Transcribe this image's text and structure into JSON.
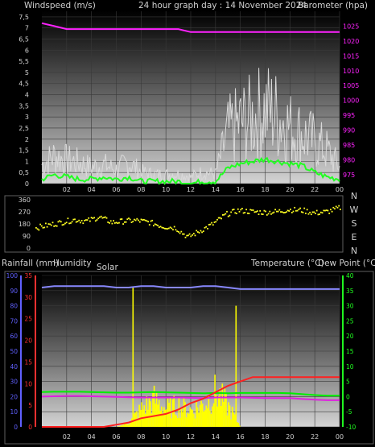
{
  "colors": {
    "background": "#000000",
    "text": "#d0d0d0",
    "windspeed": "#ffffff",
    "gust": "#d9d9d9",
    "wind_avg": "#22ff22",
    "barometer": "#ff22ff",
    "direction": "#ffff22",
    "humidity": "#8888ff",
    "rainfall": "#ff2020",
    "solar": "#ffff00",
    "temperature": "#00ee00",
    "dewpoint": "#e020e0",
    "axis_red": "#ff3030",
    "axis_blue": "#6060ff",
    "axis_green": "#20ff20"
  },
  "top_panel": {
    "title_left": "Windspeed (m/s)",
    "title_center": "24 hour graph day : 14 November 2024",
    "title_right": "Barometer (hpa)",
    "y_left_ticks": [
      "7,5",
      "7",
      "6,5",
      "6",
      "5,5",
      "5",
      "4,5",
      "4",
      "3,5",
      "3",
      "2,5",
      "2",
      "1,5",
      "1",
      "0,5",
      "0"
    ],
    "y_right_ticks": [
      "1025",
      "1020",
      "1015",
      "1010",
      "1005",
      "1000",
      "995",
      "990",
      "985",
      "980",
      "975"
    ],
    "x_ticks": [
      "02",
      "04",
      "06",
      "08",
      "10",
      "12",
      "14",
      "16",
      "18",
      "20",
      "22",
      "00"
    ]
  },
  "mid_panel": {
    "y_ticks": [
      "360",
      "270",
      "180",
      "90",
      "0"
    ],
    "compass": [
      "N",
      "W",
      "S",
      "E",
      "N"
    ]
  },
  "bottom_panel": {
    "label_rain": "Rainfall (mm)",
    "label_humidity": "Humidity",
    "label_solar": "Solar",
    "label_temp": "Temperature (°C)",
    "label_dew": "Dew Point (°C)",
    "humidity_ticks": [
      "100",
      "90",
      "80",
      "70",
      "60",
      "50",
      "40",
      "30",
      "20",
      "10",
      "0"
    ],
    "rain_ticks": [
      "35",
      "30",
      "25",
      "20",
      "15",
      "10",
      "5",
      "0"
    ],
    "temp_ticks": [
      "40",
      "35",
      "30",
      "25",
      "20",
      "15",
      "10",
      "5",
      "0",
      "-5",
      "-10"
    ],
    "x_ticks": [
      "02",
      "04",
      "06",
      "08",
      "10",
      "12",
      "14",
      "16",
      "18",
      "20",
      "22",
      "00"
    ]
  },
  "chart_data": [
    {
      "type": "line",
      "xlabel": "",
      "title": "24 hour graph day : 14 November 2024",
      "x_hours": [
        0,
        1,
        2,
        3,
        4,
        5,
        6,
        7,
        8,
        9,
        10,
        11,
        12,
        13,
        14,
        15,
        16,
        17,
        18,
        19,
        20,
        21,
        22,
        23,
        24
      ],
      "series": [
        {
          "name": "Windspeed (m/s)",
          "axis": "left",
          "ylim": [
            0,
            7.75
          ],
          "values": [
            0.8,
            1.2,
            1.0,
            0.9,
            0.7,
            0.8,
            0.6,
            0.9,
            0.5,
            0.4,
            0.4,
            0.4,
            0.3,
            0.5,
            0.4,
            2.2,
            2.6,
            2.8,
            3.2,
            2.9,
            2.4,
            2.1,
            1.8,
            1.4,
            0.7
          ]
        },
        {
          "name": "Barometer (hpa)",
          "axis": "right",
          "ylim": [
            972,
            1030
          ],
          "values": [
            1026,
            1025,
            1024,
            1024,
            1024,
            1024,
            1024,
            1024,
            1024,
            1024,
            1024,
            1024,
            1023,
            1023,
            1023,
            1023,
            1023,
            1023,
            1023,
            1023,
            1023,
            1023,
            1023,
            1023,
            1023
          ]
        }
      ],
      "wind_avg": [
        0.2,
        0.4,
        0.3,
        0.2,
        0.2,
        0.3,
        0.2,
        0.3,
        0.1,
        0.1,
        0.1,
        0.1,
        0.0,
        0.1,
        0.1,
        0.7,
        0.9,
        1.0,
        1.1,
        1.0,
        0.9,
        0.8,
        0.5,
        0.3,
        0.2
      ]
    },
    {
      "type": "scatter",
      "x_hours": [
        0,
        1,
        2,
        3,
        4,
        5,
        6,
        7,
        8,
        9,
        10,
        11,
        12,
        13,
        14,
        15,
        16,
        17,
        18,
        19,
        20,
        21,
        22,
        23,
        24
      ],
      "series": [
        {
          "name": "Wind direction",
          "ylim": [
            0,
            360
          ],
          "values": [
            150,
            170,
            190,
            210,
            200,
            230,
            190,
            200,
            205,
            190,
            160,
            150,
            80,
            130,
            180,
            250,
            280,
            270,
            265,
            270,
            285,
            280,
            260,
            270,
            300
          ]
        }
      ]
    },
    {
      "type": "line",
      "x_hours": [
        0,
        1,
        2,
        3,
        4,
        5,
        6,
        7,
        8,
        9,
        10,
        11,
        12,
        13,
        14,
        15,
        16,
        17,
        18,
        19,
        20,
        21,
        22,
        23,
        24
      ],
      "series": [
        {
          "name": "Humidity",
          "axis": "humidity",
          "ylim": [
            0,
            100
          ],
          "values": [
            92,
            93,
            93,
            93,
            93,
            93,
            92,
            92,
            93,
            93,
            92,
            92,
            92,
            93,
            93,
            92,
            91,
            91,
            91,
            91,
            91,
            91,
            91,
            91,
            91
          ]
        },
        {
          "name": "Rainfall (mm)",
          "axis": "rain",
          "ylim": [
            0,
            35
          ],
          "values": [
            0,
            0,
            0,
            0,
            0,
            0,
            0.5,
            1,
            2,
            2.5,
            3,
            4,
            5.5,
            6.5,
            8,
            9.5,
            10.5,
            11.5,
            11.5,
            11.5,
            11.5,
            11.5,
            11.5,
            11.5,
            11.5
          ]
        },
        {
          "name": "Temperature (°C)",
          "axis": "temp",
          "ylim": [
            -10,
            40
          ],
          "values": [
            1.5,
            1.6,
            1.6,
            1.6,
            1.5,
            1.4,
            1.3,
            1.3,
            1.4,
            1.5,
            1.4,
            1.3,
            1.2,
            1.1,
            1.2,
            1.1,
            1.2,
            1.2,
            1.2,
            1.2,
            1.1,
            0.8,
            0.5,
            0.3,
            0.3
          ]
        },
        {
          "name": "Dew Point (°C)",
          "axis": "temp",
          "ylim": [
            -10,
            40
          ],
          "values": [
            0.0,
            0.1,
            0.2,
            0.2,
            0.1,
            0.0,
            -0.1,
            -0.2,
            -0.3,
            -0.3,
            -0.3,
            -0.3,
            -0.4,
            -0.5,
            -0.3,
            -0.3,
            -0.3,
            -0.4,
            -0.5,
            -0.5,
            -0.5,
            -0.8,
            -1.0,
            -1.2,
            -1.2
          ]
        },
        {
          "name": "Solar",
          "axis": "solar",
          "ylim": [
            0,
            1000
          ],
          "values": [
            0,
            0,
            0,
            0,
            0,
            0,
            0,
            30,
            120,
            180,
            120,
            140,
            110,
            150,
            230,
            130,
            0,
            0,
            0,
            0,
            0,
            0,
            0,
            0,
            0
          ]
        }
      ]
    }
  ]
}
